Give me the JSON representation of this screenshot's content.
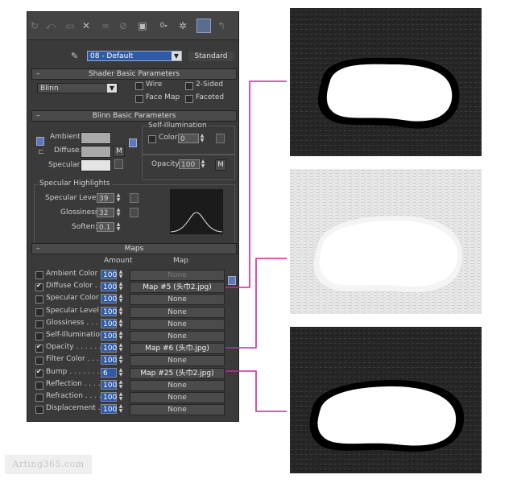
{
  "toolbar": {
    "icons": [
      "rotate-icon",
      "undo-icon",
      "copy-icon",
      "delete-icon",
      "link-icon",
      "unlink-icon",
      "material-id-icon",
      "channel-icon",
      "globe-icon",
      "show-map-icon",
      "go-back-icon"
    ],
    "channel_value": "0"
  },
  "material": {
    "name": "08 - Default",
    "type_button": "Standard"
  },
  "shader_basic": {
    "title": "Shader Basic Parameters",
    "shader": "Blinn",
    "wire": "Wire",
    "two_sided": "2-Sided",
    "face_map": "Face Map",
    "faceted": "Faceted"
  },
  "blinn_basic": {
    "title": "Blinn Basic Parameters",
    "ambient": "Ambient:",
    "diffuse": "Diffuse:",
    "specular": "Specular:",
    "diffuse_map_btn": "M",
    "self_illum_title": "Self-Illumination",
    "color_label": "Color",
    "color_value": "0",
    "opacity_label": "Opacity:",
    "opacity_value": "100",
    "opacity_map_btn": "M",
    "spec_title": "Specular Highlights",
    "spec_level_label": "Specular Level:",
    "spec_level_value": "39",
    "glossiness_label": "Glossiness:",
    "glossiness_value": "32",
    "soften_label": "Soften:",
    "soften_value": "0.1"
  },
  "maps": {
    "title": "Maps",
    "amount_header": "Amount",
    "map_header": "Map",
    "rows": [
      {
        "label": "Ambient Color . .",
        "amount": "100",
        "map": "None",
        "checked": false
      },
      {
        "label": "Diffuse Color . . .",
        "amount": "100",
        "map": "Map #5 (头巾2.jpg)",
        "checked": true
      },
      {
        "label": "Specular Color . .",
        "amount": "100",
        "map": "None",
        "checked": false
      },
      {
        "label": "Specular Level . .",
        "amount": "100",
        "map": "None",
        "checked": false
      },
      {
        "label": "Glossiness . . . . .",
        "amount": "100",
        "map": "None",
        "checked": false
      },
      {
        "label": "Self-Illumination .",
        "amount": "100",
        "map": "None",
        "checked": false
      },
      {
        "label": "Opacity . . . . . . .",
        "amount": "100",
        "map": "Map #6 (头巾.jpg)",
        "checked": true
      },
      {
        "label": "Filter Color . . . .",
        "amount": "100",
        "map": "None",
        "checked": false
      },
      {
        "label": "Bump . . . . . . . .",
        "amount": "6",
        "map": "Map #25 (头巾2.jpg)",
        "checked": true
      },
      {
        "label": "Reflection . . . . .",
        "amount": "100",
        "map": "None",
        "checked": false
      },
      {
        "label": "Refraction . . . . .",
        "amount": "100",
        "map": "None",
        "checked": false
      },
      {
        "label": "Displacement . .",
        "amount": "100",
        "map": "None",
        "checked": false
      }
    ]
  },
  "watermark": "Arting365.com",
  "colors": {
    "connector": "#d0279b",
    "panel_bg": "#3a3a3a",
    "highlight": "#2f5aa8"
  }
}
